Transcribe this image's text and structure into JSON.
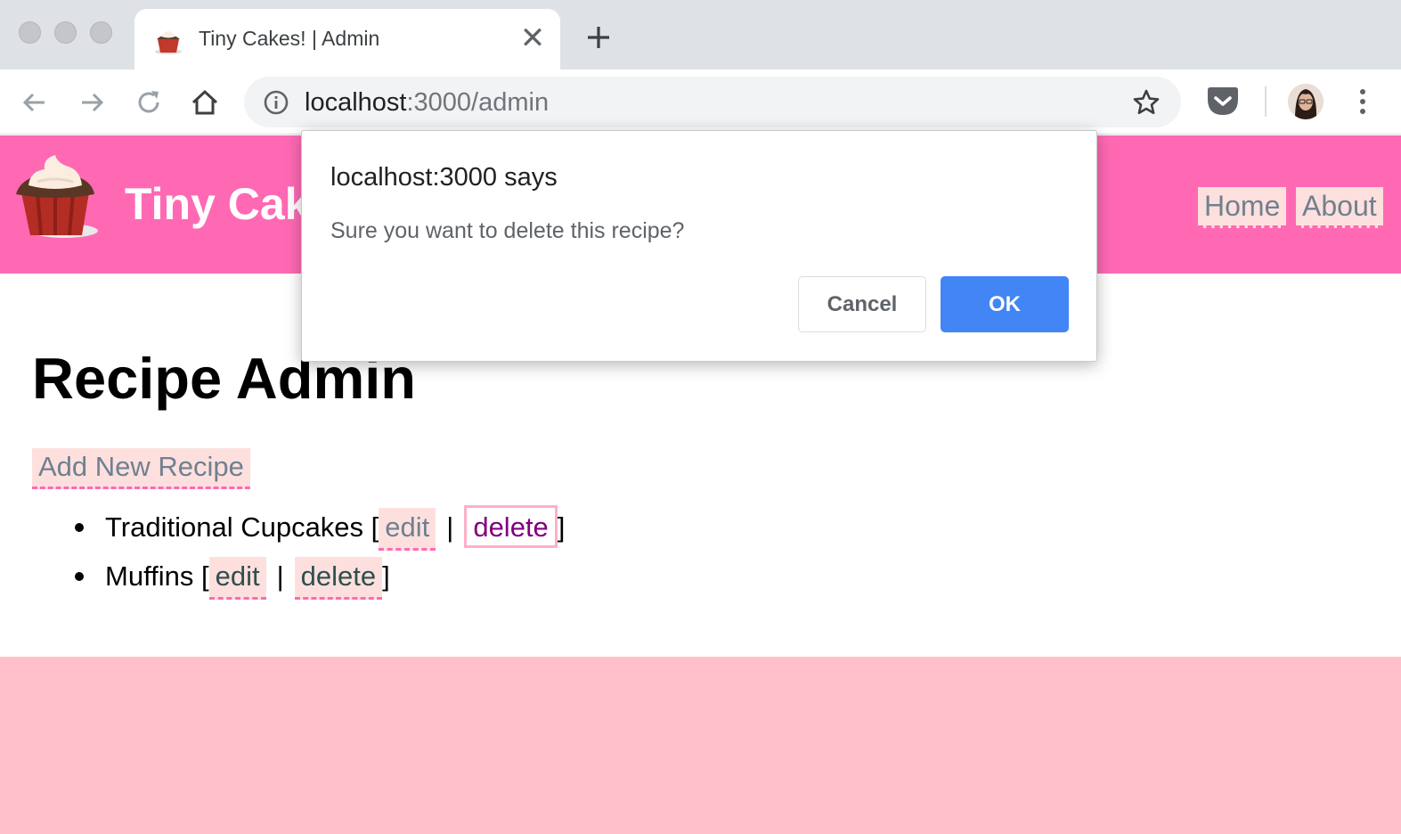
{
  "browser": {
    "tab": {
      "title": "Tiny Cakes! | Admin",
      "close_glyph": "✕"
    },
    "address": {
      "host": "localhost",
      "path": ":3000/admin"
    }
  },
  "site": {
    "title": "Tiny Cak",
    "nav": [
      {
        "label": "Home"
      },
      {
        "label": "About"
      }
    ]
  },
  "page": {
    "heading": "Recipe Admin",
    "add_link": "Add New Recipe",
    "recipes": [
      {
        "name": "Traditional Cupcakes [",
        "edit": "edit",
        "sep": "|",
        "delete": "delete",
        "close": "]"
      },
      {
        "name": "Muffins [",
        "edit": "edit",
        "sep": "|",
        "delete": "delete",
        "close": "]"
      }
    ]
  },
  "dialog": {
    "title": "localhost:3000 says",
    "message": "Sure you want to delete this recipe?",
    "cancel_label": "Cancel",
    "ok_label": "OK"
  },
  "colors": {
    "header_bg": "#ff69b4",
    "footer_bg": "#ffc0cb",
    "link_bg": "#fde0dd",
    "ok_button": "#4285f4"
  }
}
